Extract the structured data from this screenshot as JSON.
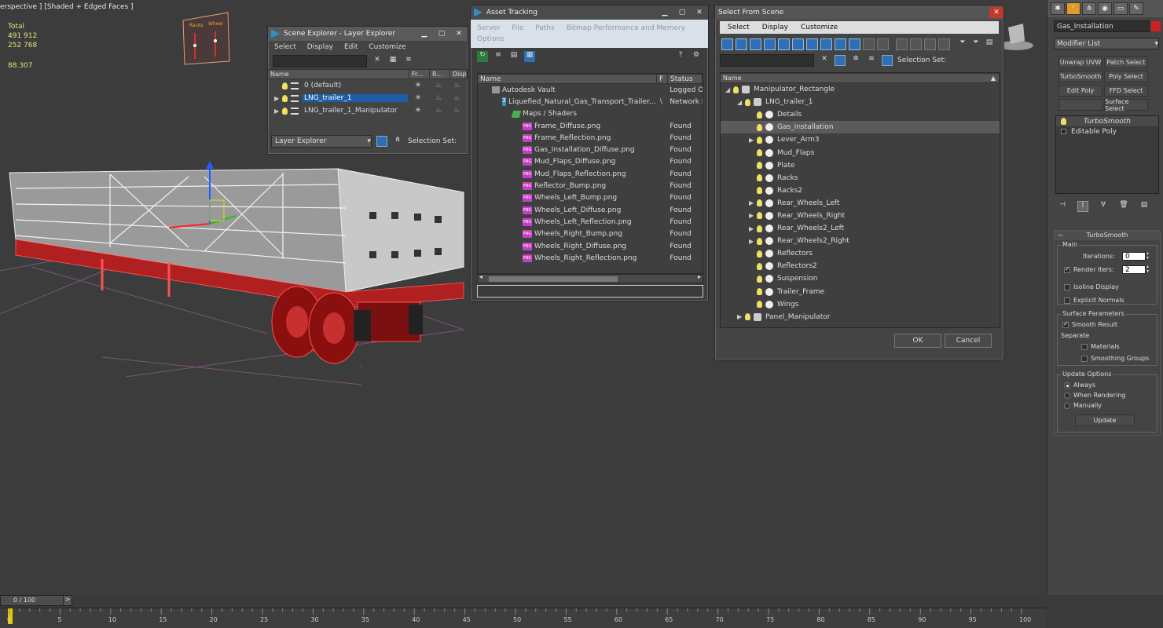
{
  "viewport": {
    "label": "erspective ] [Shaded + Edged Faces ]",
    "stats": {
      "total_label": "Total",
      "polys": "491 912",
      "verts": "252 768",
      "fps": "88.307"
    },
    "manipulator_labels": [
      "Racks",
      "Wheel"
    ]
  },
  "scene_explorer": {
    "title": "Scene Explorer - Layer Explorer",
    "menu": [
      "Select",
      "Display",
      "Edit",
      "Customize"
    ],
    "columns": [
      "Name",
      "Fr...",
      "R...",
      "Disp"
    ],
    "rows": [
      {
        "label": "0 (default)",
        "selected": false,
        "expandable": false
      },
      {
        "label": "LNG_trailer_1",
        "selected": true,
        "expandable": true
      },
      {
        "label": "LNG_trailer_1_Manipulator",
        "selected": false,
        "expandable": true
      }
    ],
    "footer_combo": "Layer Explorer",
    "selection_set_label": "Selection Set:"
  },
  "asset_tracking": {
    "title": "Asset Tracking",
    "menu_line1": [
      "Server",
      "File",
      "Paths",
      "Bitmap Performance and Memory"
    ],
    "menu_line2": [
      "Options"
    ],
    "columns": {
      "name": "Name",
      "flag": "F",
      "status": "Status"
    },
    "rows": [
      {
        "indent": 0,
        "icon": "vault",
        "name": "Autodesk Vault",
        "flag": "",
        "status": "Logged O"
      },
      {
        "indent": 1,
        "icon": "max",
        "name": "Liquefied_Natural_Gas_Transport_Trailer...",
        "flag": "\\",
        "status": "Network P"
      },
      {
        "indent": 2,
        "icon": "maps",
        "name": "Maps / Shaders",
        "flag": "",
        "status": ""
      },
      {
        "indent": 3,
        "icon": "png",
        "name": "Frame_Diffuse.png",
        "flag": "",
        "status": "Found"
      },
      {
        "indent": 3,
        "icon": "png",
        "name": "Frame_Reflection.png",
        "flag": "",
        "status": "Found"
      },
      {
        "indent": 3,
        "icon": "png",
        "name": "Gas_Installation_Diffuse.png",
        "flag": "",
        "status": "Found"
      },
      {
        "indent": 3,
        "icon": "png",
        "name": "Mud_Flaps_Diffuse.png",
        "flag": "",
        "status": "Found"
      },
      {
        "indent": 3,
        "icon": "png",
        "name": "Mud_Flaps_Reflection.png",
        "flag": "",
        "status": "Found"
      },
      {
        "indent": 3,
        "icon": "png",
        "name": "Reflector_Bump.png",
        "flag": "",
        "status": "Found"
      },
      {
        "indent": 3,
        "icon": "png",
        "name": "Wheels_Left_Bump.png",
        "flag": "",
        "status": "Found"
      },
      {
        "indent": 3,
        "icon": "png",
        "name": "Wheels_Left_Diffuse.png",
        "flag": "",
        "status": "Found"
      },
      {
        "indent": 3,
        "icon": "png",
        "name": "Wheels_Left_Reflection.png",
        "flag": "",
        "status": "Found"
      },
      {
        "indent": 3,
        "icon": "png",
        "name": "Wheels_Right_Bump.png",
        "flag": "",
        "status": "Found"
      },
      {
        "indent": 3,
        "icon": "png",
        "name": "Wheels_Right_Diffuse.png",
        "flag": "",
        "status": "Found"
      },
      {
        "indent": 3,
        "icon": "png",
        "name": "Wheels_Right_Reflection.png",
        "flag": "",
        "status": "Found"
      }
    ],
    "png_badge": "PNG",
    "max_badge": "3"
  },
  "select_from_scene": {
    "title": "Select From Scene",
    "menu": [
      "Select",
      "Display",
      "Customize"
    ],
    "selection_set_label": "Selection Set:",
    "column_name": "Name",
    "rows": [
      {
        "indent": 0,
        "expander": "open",
        "icon": "group",
        "label": "Manipulator_Rectangle",
        "hl": false
      },
      {
        "indent": 1,
        "expander": "open",
        "icon": "group",
        "label": "LNG_trailer_1",
        "hl": false
      },
      {
        "indent": 2,
        "expander": "",
        "icon": "ball",
        "label": "Details",
        "hl": false
      },
      {
        "indent": 2,
        "expander": "",
        "icon": "ball",
        "label": "Gas_Installation",
        "hl": true
      },
      {
        "indent": 2,
        "expander": "closed",
        "icon": "ball",
        "label": "Lever_Arm3",
        "hl": false
      },
      {
        "indent": 2,
        "expander": "",
        "icon": "ball",
        "label": "Mud_Flaps",
        "hl": false
      },
      {
        "indent": 2,
        "expander": "",
        "icon": "ball",
        "label": "Plate",
        "hl": false
      },
      {
        "indent": 2,
        "expander": "",
        "icon": "ball",
        "label": "Racks",
        "hl": false
      },
      {
        "indent": 2,
        "expander": "",
        "icon": "ball",
        "label": "Racks2",
        "hl": false
      },
      {
        "indent": 2,
        "expander": "closed",
        "icon": "ball",
        "label": "Rear_Wheels_Left",
        "hl": false
      },
      {
        "indent": 2,
        "expander": "closed",
        "icon": "ball",
        "label": "Rear_Wheels_Right",
        "hl": false
      },
      {
        "indent": 2,
        "expander": "closed",
        "icon": "ball",
        "label": "Rear_Wheels2_Left",
        "hl": false
      },
      {
        "indent": 2,
        "expander": "closed",
        "icon": "ball",
        "label": "Rear_Wheels2_Right",
        "hl": false
      },
      {
        "indent": 2,
        "expander": "",
        "icon": "ball",
        "label": "Reflectors",
        "hl": false
      },
      {
        "indent": 2,
        "expander": "",
        "icon": "ball",
        "label": "Reflectors2",
        "hl": false
      },
      {
        "indent": 2,
        "expander": "",
        "icon": "ball",
        "label": "Suspension",
        "hl": false
      },
      {
        "indent": 2,
        "expander": "",
        "icon": "ball",
        "label": "Trailer_Frame",
        "hl": false
      },
      {
        "indent": 2,
        "expander": "",
        "icon": "ball",
        "label": "Wings",
        "hl": false
      },
      {
        "indent": 1,
        "expander": "closed",
        "icon": "group",
        "label": "Panel_Manipulator",
        "hl": false
      }
    ],
    "ok_label": "OK",
    "cancel_label": "Cancel"
  },
  "command_panel": {
    "object_name": "Gas_Installation",
    "modifier_list": "Modifier List",
    "modifier_buttons": [
      "Unwrap UVW",
      "Patch Select",
      "TurboSmooth",
      "Poly Select",
      "Edit Poly",
      "FFD Select",
      "",
      "Surface Select"
    ],
    "stack": [
      "TurboSmooth",
      "Editable Poly"
    ],
    "rollout_title": "TurboSmooth",
    "main_group": "Main",
    "iterations_label": "Iterations:",
    "iterations_value": "0",
    "render_iters_label": "Render Iters:",
    "render_iters_value": "2",
    "isoline_label": "Isoline Display",
    "explicit_normals_label": "Explicit Normals",
    "surface_group": "Surface Parameters",
    "smooth_result_label": "Smooth Result",
    "separate_label": "Separate",
    "materials_label": "Materials",
    "smoothing_groups_label": "Smoothing Groups",
    "update_group": "Update Options",
    "update_always": "Always",
    "update_rendering": "When Rendering",
    "update_manually": "Manually",
    "update_button": "Update",
    "accent_color": "#e09a2a"
  },
  "timeline": {
    "frame_readout": "0 / 100",
    "next_label": ">",
    "ticks": [
      "0",
      "5",
      "10",
      "15",
      "20",
      "25",
      "30",
      "35",
      "40",
      "45",
      "50",
      "55",
      "60",
      "65",
      "70",
      "75",
      "80",
      "85",
      "90",
      "95",
      "100"
    ]
  }
}
